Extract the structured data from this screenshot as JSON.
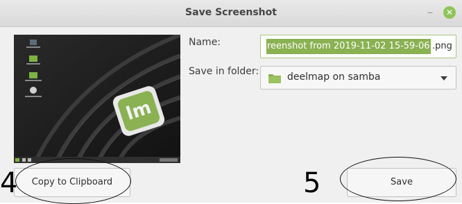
{
  "window": {
    "title": "Save Screenshot",
    "minimize_glyph": "–",
    "close_glyph": "✕",
    "accent_color": "#8ab152"
  },
  "form": {
    "name_label": "Name:",
    "name_value_selected": "reenshot from 2019-11-02 15-59-06",
    "name_value_rest": ".png",
    "folder_label": "Save in folder:",
    "folder_value": "deelmap on samba",
    "folder_icon": "folder-icon"
  },
  "buttons": {
    "copy_label": "Copy to Clipboard",
    "save_label": "Save"
  },
  "annotations": {
    "copy_number": "4",
    "save_number": "5"
  },
  "preview": {
    "image": "linux-mint-desktop-thumbnail",
    "logo_letters": "lm"
  }
}
